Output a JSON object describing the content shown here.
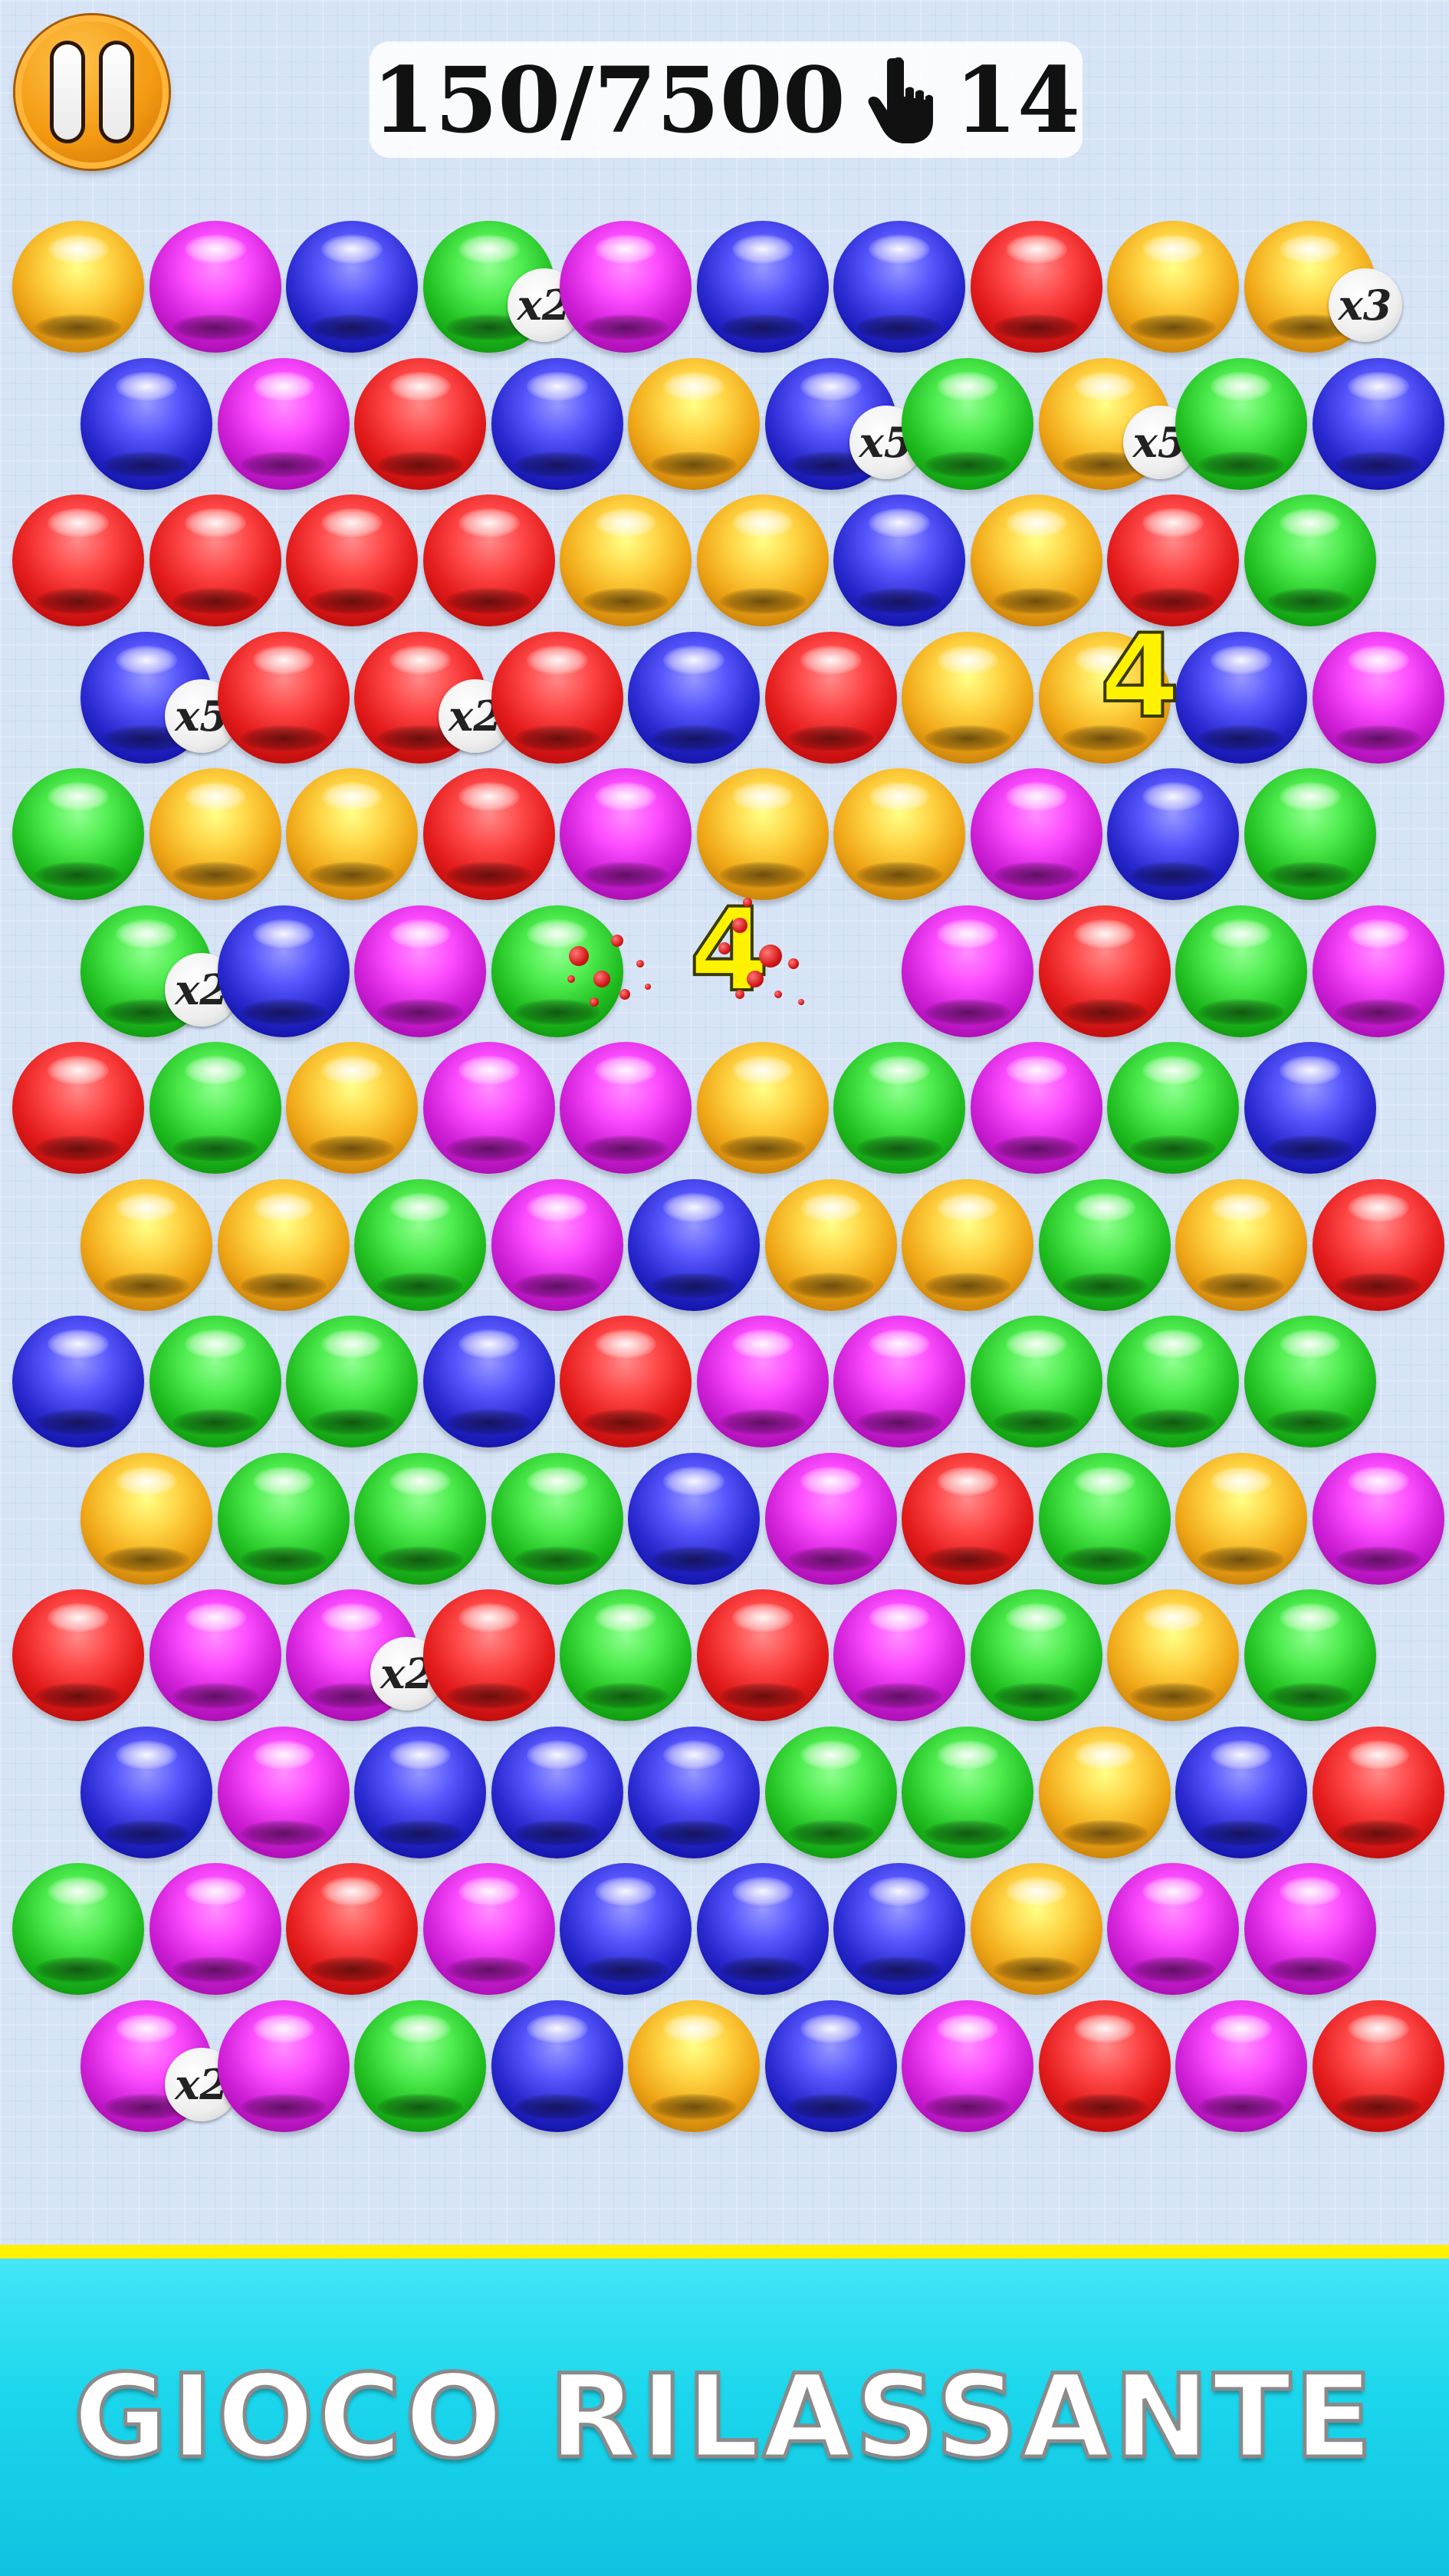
{
  "hud": {
    "score_text": "150/7500",
    "moves_left": "14",
    "pause_icon": "pause-icon",
    "moves_icon": "hand-tap-icon"
  },
  "colors": {
    "Y": "#f0a818",
    "M": "#d020d8",
    "B": "#2a2ad0",
    "G": "#22c022",
    "R": "#e41c1c"
  },
  "board": {
    "rows": [
      [
        "Y",
        "M",
        "B",
        "G",
        "M",
        "B",
        "B",
        "R",
        "Y",
        "Y"
      ],
      [
        "B",
        "M",
        "R",
        "B",
        "Y",
        "B",
        "G",
        "Y",
        "G",
        "B"
      ],
      [
        "R",
        "R",
        "R",
        "R",
        "Y",
        "Y",
        "B",
        "Y",
        "R",
        "G"
      ],
      [
        "B",
        "R",
        "R",
        "R",
        "B",
        "R",
        "Y",
        "Y",
        "B",
        "M"
      ],
      [
        "G",
        "Y",
        "Y",
        "R",
        "M",
        "Y",
        "Y",
        "M",
        "B",
        "G"
      ],
      [
        "G",
        "B",
        "M",
        "G",
        "",
        "",
        "M",
        "R",
        "G",
        "M"
      ],
      [
        "R",
        "G",
        "Y",
        "M",
        "M",
        "Y",
        "G",
        "M",
        "G",
        "B"
      ],
      [
        "Y",
        "Y",
        "G",
        "M",
        "B",
        "Y",
        "Y",
        "G",
        "Y",
        "R"
      ],
      [
        "B",
        "G",
        "G",
        "B",
        "R",
        "M",
        "M",
        "G",
        "G",
        "G"
      ],
      [
        "Y",
        "G",
        "G",
        "G",
        "B",
        "M",
        "R",
        "G",
        "Y",
        "M"
      ],
      [
        "R",
        "M",
        "M",
        "R",
        "G",
        "R",
        "M",
        "G",
        "Y",
        "G"
      ],
      [
        "B",
        "M",
        "B",
        "B",
        "B",
        "G",
        "G",
        "Y",
        "B",
        "R"
      ],
      [
        "G",
        "M",
        "R",
        "M",
        "B",
        "B",
        "B",
        "Y",
        "M",
        "M"
      ],
      [
        "M",
        "M",
        "G",
        "B",
        "Y",
        "B",
        "M",
        "R",
        "M",
        "R"
      ]
    ],
    "multipliers": [
      {
        "row": 0,
        "col": 3,
        "label": "x2"
      },
      {
        "row": 0,
        "col": 9,
        "label": "x3"
      },
      {
        "row": 1,
        "col": 5,
        "label": "x5"
      },
      {
        "row": 1,
        "col": 7,
        "label": "x5"
      },
      {
        "row": 3,
        "col": 0,
        "label": "x5"
      },
      {
        "row": 3,
        "col": 2,
        "label": "x2"
      },
      {
        "row": 5,
        "col": 0,
        "label": "x2"
      },
      {
        "row": 10,
        "col": 2,
        "label": "x2"
      },
      {
        "row": 13,
        "col": 0,
        "label": "x2"
      }
    ],
    "floating_numbers": [
      {
        "text": "4",
        "row": 3,
        "col": 7
      },
      {
        "text": "4",
        "row": 5,
        "col": 4
      }
    ]
  },
  "footer": {
    "text": "GIOCO RILASSANTE"
  }
}
